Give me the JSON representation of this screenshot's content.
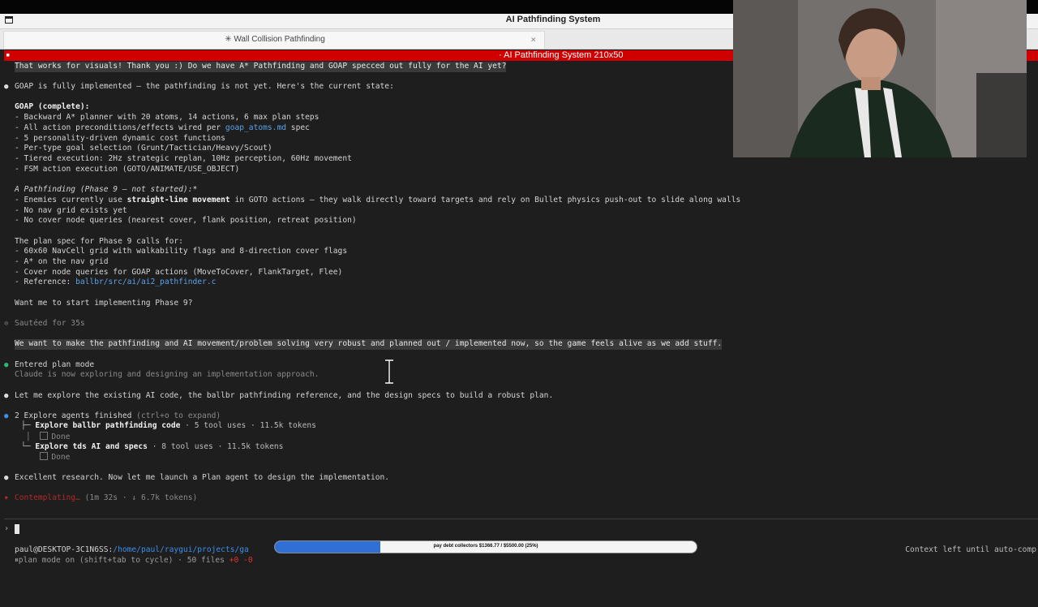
{
  "window": {
    "title": "AI Pathfinding System",
    "tab_title": "✳ Wall Collision Pathfinding",
    "tab_close": "×",
    "pane_title": "· AI Pathfinding System 210x50"
  },
  "transcript": {
    "user_1": "That works for visuals! Thank you :) Do we have A* Pathfinding and GOAP specced out fully for the AI yet?",
    "reply_intro": "GOAP is fully implemented — the pathfinding is not yet. Here's the current state:",
    "goap_heading": "GOAP (complete):",
    "goap_1": "- Backward A* planner with 20 atoms, 14 actions, 6 max plan steps",
    "goap_2_pre": "- All action preconditions/effects wired per ",
    "goap_2_link": "goap_atoms.md",
    "goap_2_post": " spec",
    "goap_3": "- 5 personality-driven dynamic cost functions",
    "goap_4": "- Per-type goal selection (Grunt/Tactician/Heavy/Scout)",
    "goap_5": "- Tiered execution: 2Hz strategic replan, 10Hz perception, 60Hz movement",
    "goap_6": "- FSM action execution (GOTO/ANIMATE/USE_OBJECT)",
    "astar_heading": "A Pathfinding (Phase 9 — not started):*",
    "astar_1_pre": "- Enemies currently use ",
    "astar_1_bold": "straight-line movement",
    "astar_1_post": " in GOTO actions — they walk directly toward targets and rely on Bullet physics push-out to slide along walls",
    "astar_2": "- No nav grid exists yet",
    "astar_3": "- No cover node queries (nearest cover, flank position, retreat position)",
    "plan_heading": "The plan spec for Phase 9 calls for:",
    "plan_1": "- 60x60 NavCell grid with walkability flags and 8-direction cover flags",
    "plan_2": "- A* on the nav grid",
    "plan_3": "- Cover node queries for GOAP actions (MoveToCover, FlankTarget, Flee)",
    "plan_4_pre": "- Reference: ",
    "plan_4_link": "ballbr/src/ai/ai2_pathfinder.c",
    "ask": "Want me to start implementing Phase 9?",
    "timer": "Sautéed for 35s",
    "user_2": "We want to make the pathfinding and AI movement/problem solving very robust and planned out / implemented now, so the game feels alive as we add stuff.",
    "plan_mode": "Entered plan mode",
    "plan_mode_sub": "Claude is now exploring and designing an implementation approach.",
    "explore": "Let me explore the existing AI code, the ballbr pathfinding reference, and the design specs to build a robust plan.",
    "agents_finished": "2 Explore agents finished",
    "agents_hint": " (ctrl+o to expand)",
    "agent_1_name": "Explore ballbr pathfinding code",
    "agent_1_stats": " · 5 tool uses · 11.5k tokens",
    "agent_1_status": "Done",
    "agent_2_name": "Explore tds AI and specs",
    "agent_2_stats": " · 8 tool uses · 11.5k tokens",
    "agent_2_status": "Done",
    "research": "Excellent research. Now let me launch a Plan agent to design the implementation.",
    "thinking": "Contemplating…",
    "thinking_stats": " (1m 32s · ↓ 6.7k tokens)"
  },
  "input": {
    "prompt_symbol": "›"
  },
  "status": {
    "host": "paul@DESKTOP-3C1N6SS:",
    "path": "/home/paul/raygui/projects/ga",
    "mode": "plan mode on (shift+tab to cycle) · 50 files ",
    "mode_red": "+0 -0",
    "context": "Context left until auto-comp"
  },
  "overlay": {
    "progress_text": "pay debt collectors $1366.77 / $5500.00 (25%)",
    "progress_fraction": 0.25
  },
  "colors": {
    "red_bar": "#d10000",
    "bullet_green": "#2eb875",
    "bullet_blue": "#3b8eea",
    "link_blue": "#5aa2e8"
  }
}
